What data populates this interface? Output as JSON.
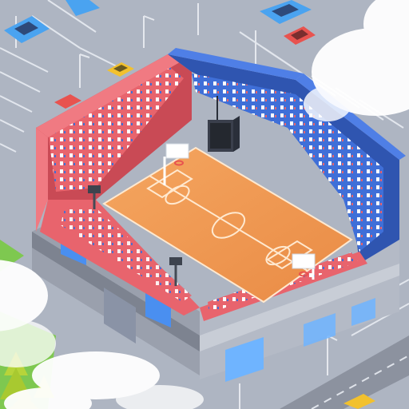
{
  "scene": {
    "type": "isometric-city-builder",
    "subject": "basketball-arena",
    "palette": {
      "parking_lot": "#aeb5c2",
      "parking_line": "#e8ecf2",
      "road": "#8c929f",
      "grass": "#7ec850",
      "tree": "#b7d43a",
      "cloud": "#ffffff",
      "stand_red": "#e8646d",
      "stand_red_dark": "#c94a55",
      "stand_blue": "#3f6fd8",
      "stand_blue_dark": "#2f55b0",
      "court_wood": "#f29a52",
      "court_line": "#ffe9d0",
      "seat_white": "#ffffff",
      "base_wall": "#9aa0ad",
      "glass": "#6fb4ff",
      "car_blue": "#4aa3f0",
      "car_red": "#e8534f",
      "car_yellow": "#f2c12e"
    },
    "elements": [
      "parking-lot",
      "arena-stands-red",
      "arena-stands-blue",
      "basketball-court",
      "scoreboard",
      "hoops",
      "floodlights",
      "parked-cars",
      "trees",
      "clouds"
    ]
  }
}
